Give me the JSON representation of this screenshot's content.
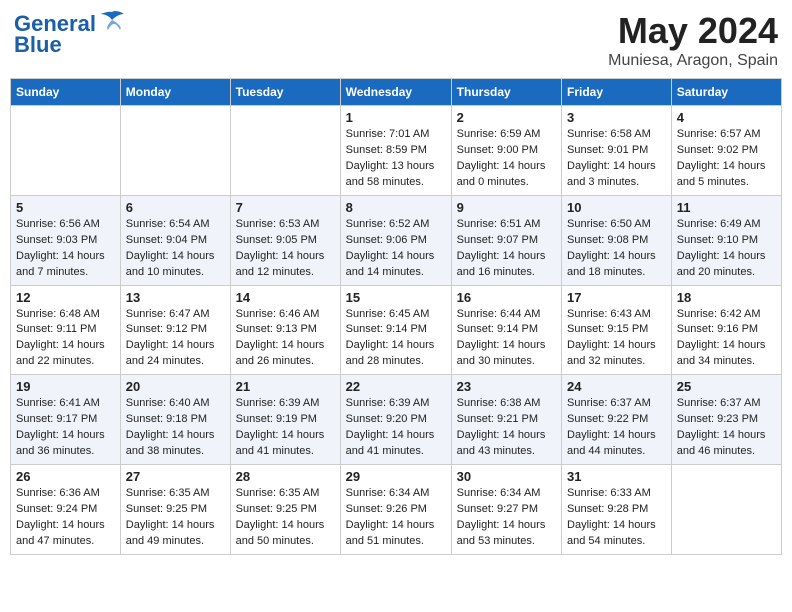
{
  "header": {
    "logo_line1": "General",
    "logo_line2": "Blue",
    "month": "May 2024",
    "location": "Muniesa, Aragon, Spain"
  },
  "weekdays": [
    "Sunday",
    "Monday",
    "Tuesday",
    "Wednesday",
    "Thursday",
    "Friday",
    "Saturday"
  ],
  "weeks": [
    [
      {
        "day": "",
        "info": ""
      },
      {
        "day": "",
        "info": ""
      },
      {
        "day": "",
        "info": ""
      },
      {
        "day": "1",
        "info": "Sunrise: 7:01 AM\nSunset: 8:59 PM\nDaylight: 13 hours\nand 58 minutes."
      },
      {
        "day": "2",
        "info": "Sunrise: 6:59 AM\nSunset: 9:00 PM\nDaylight: 14 hours\nand 0 minutes."
      },
      {
        "day": "3",
        "info": "Sunrise: 6:58 AM\nSunset: 9:01 PM\nDaylight: 14 hours\nand 3 minutes."
      },
      {
        "day": "4",
        "info": "Sunrise: 6:57 AM\nSunset: 9:02 PM\nDaylight: 14 hours\nand 5 minutes."
      }
    ],
    [
      {
        "day": "5",
        "info": "Sunrise: 6:56 AM\nSunset: 9:03 PM\nDaylight: 14 hours\nand 7 minutes."
      },
      {
        "day": "6",
        "info": "Sunrise: 6:54 AM\nSunset: 9:04 PM\nDaylight: 14 hours\nand 10 minutes."
      },
      {
        "day": "7",
        "info": "Sunrise: 6:53 AM\nSunset: 9:05 PM\nDaylight: 14 hours\nand 12 minutes."
      },
      {
        "day": "8",
        "info": "Sunrise: 6:52 AM\nSunset: 9:06 PM\nDaylight: 14 hours\nand 14 minutes."
      },
      {
        "day": "9",
        "info": "Sunrise: 6:51 AM\nSunset: 9:07 PM\nDaylight: 14 hours\nand 16 minutes."
      },
      {
        "day": "10",
        "info": "Sunrise: 6:50 AM\nSunset: 9:08 PM\nDaylight: 14 hours\nand 18 minutes."
      },
      {
        "day": "11",
        "info": "Sunrise: 6:49 AM\nSunset: 9:10 PM\nDaylight: 14 hours\nand 20 minutes."
      }
    ],
    [
      {
        "day": "12",
        "info": "Sunrise: 6:48 AM\nSunset: 9:11 PM\nDaylight: 14 hours\nand 22 minutes."
      },
      {
        "day": "13",
        "info": "Sunrise: 6:47 AM\nSunset: 9:12 PM\nDaylight: 14 hours\nand 24 minutes."
      },
      {
        "day": "14",
        "info": "Sunrise: 6:46 AM\nSunset: 9:13 PM\nDaylight: 14 hours\nand 26 minutes."
      },
      {
        "day": "15",
        "info": "Sunrise: 6:45 AM\nSunset: 9:14 PM\nDaylight: 14 hours\nand 28 minutes."
      },
      {
        "day": "16",
        "info": "Sunrise: 6:44 AM\nSunset: 9:14 PM\nDaylight: 14 hours\nand 30 minutes."
      },
      {
        "day": "17",
        "info": "Sunrise: 6:43 AM\nSunset: 9:15 PM\nDaylight: 14 hours\nand 32 minutes."
      },
      {
        "day": "18",
        "info": "Sunrise: 6:42 AM\nSunset: 9:16 PM\nDaylight: 14 hours\nand 34 minutes."
      }
    ],
    [
      {
        "day": "19",
        "info": "Sunrise: 6:41 AM\nSunset: 9:17 PM\nDaylight: 14 hours\nand 36 minutes."
      },
      {
        "day": "20",
        "info": "Sunrise: 6:40 AM\nSunset: 9:18 PM\nDaylight: 14 hours\nand 38 minutes."
      },
      {
        "day": "21",
        "info": "Sunrise: 6:39 AM\nSunset: 9:19 PM\nDaylight: 14 hours\nand 41 minutes."
      },
      {
        "day": "22",
        "info": "Sunrise: 6:39 AM\nSunset: 9:20 PM\nDaylight: 14 hours\nand 41 minutes."
      },
      {
        "day": "23",
        "info": "Sunrise: 6:38 AM\nSunset: 9:21 PM\nDaylight: 14 hours\nand 43 minutes."
      },
      {
        "day": "24",
        "info": "Sunrise: 6:37 AM\nSunset: 9:22 PM\nDaylight: 14 hours\nand 44 minutes."
      },
      {
        "day": "25",
        "info": "Sunrise: 6:37 AM\nSunset: 9:23 PM\nDaylight: 14 hours\nand 46 minutes."
      }
    ],
    [
      {
        "day": "26",
        "info": "Sunrise: 6:36 AM\nSunset: 9:24 PM\nDaylight: 14 hours\nand 47 minutes."
      },
      {
        "day": "27",
        "info": "Sunrise: 6:35 AM\nSunset: 9:25 PM\nDaylight: 14 hours\nand 49 minutes."
      },
      {
        "day": "28",
        "info": "Sunrise: 6:35 AM\nSunset: 9:25 PM\nDaylight: 14 hours\nand 50 minutes."
      },
      {
        "day": "29",
        "info": "Sunrise: 6:34 AM\nSunset: 9:26 PM\nDaylight: 14 hours\nand 51 minutes."
      },
      {
        "day": "30",
        "info": "Sunrise: 6:34 AM\nSunset: 9:27 PM\nDaylight: 14 hours\nand 53 minutes."
      },
      {
        "day": "31",
        "info": "Sunrise: 6:33 AM\nSunset: 9:28 PM\nDaylight: 14 hours\nand 54 minutes."
      },
      {
        "day": "",
        "info": ""
      }
    ]
  ]
}
